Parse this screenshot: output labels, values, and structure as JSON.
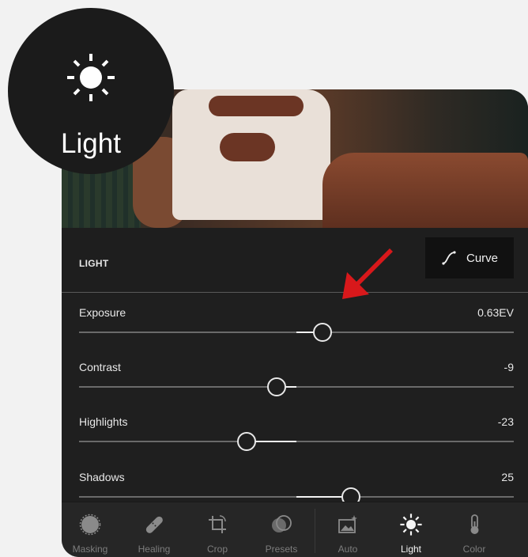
{
  "badge": {
    "label": "Light",
    "icon": "sun-icon"
  },
  "panel": {
    "section_title": "LIGHT",
    "curve_button": {
      "label": "Curve",
      "icon": "curve-icon"
    }
  },
  "sliders": [
    {
      "label": "Exposure",
      "value": "0.63EV",
      "position": 0.56
    },
    {
      "label": "Contrast",
      "value": "-9",
      "position": 0.455
    },
    {
      "label": "Highlights",
      "value": "-23",
      "position": 0.385
    },
    {
      "label": "Shadows",
      "value": "25",
      "position": 0.625
    }
  ],
  "toolbar": [
    {
      "label": "Masking",
      "icon": "masking-icon",
      "active": false
    },
    {
      "label": "Healing",
      "icon": "bandage-icon",
      "active": false
    },
    {
      "label": "Crop",
      "icon": "crop-icon",
      "active": false
    },
    {
      "label": "Presets",
      "icon": "presets-icon",
      "active": false
    },
    {
      "label": "Auto",
      "icon": "auto-icon",
      "active": false
    },
    {
      "label": "Light",
      "icon": "sun-icon",
      "active": true
    },
    {
      "label": "Color",
      "icon": "thermometer-icon",
      "active": false
    }
  ],
  "colors": {
    "arrow": "#d8181b",
    "accent_active": "#f5f5f5"
  }
}
